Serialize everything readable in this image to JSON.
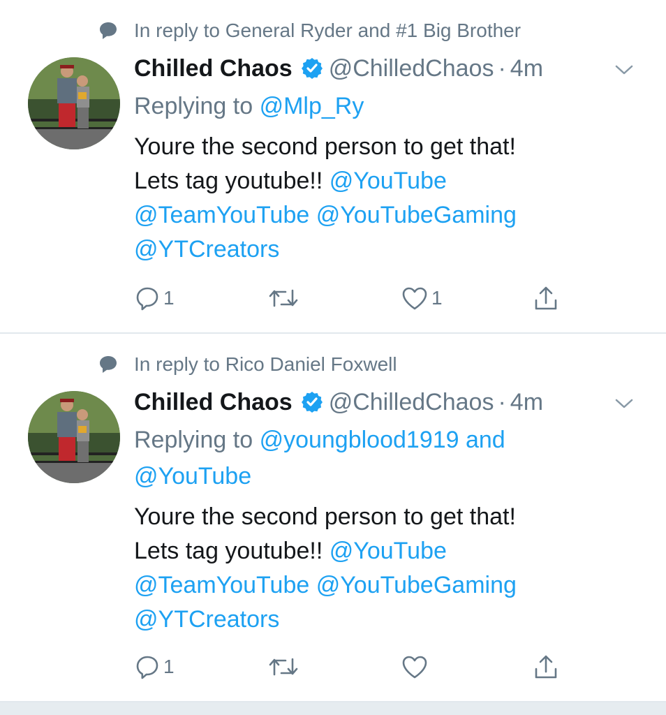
{
  "tweets": [
    {
      "context_text": "In reply to General Ryder and #1 Big Brother",
      "name": "Chilled Chaos",
      "handle": "@ChilledChaos",
      "dot": "·",
      "time": "4m",
      "replying_prefix": "Replying to",
      "replying_line1": "@Mlp_Ry",
      "replying_line2": "",
      "text_line1": "Youre the second person to get that!",
      "text_line2_plain": "Lets tag youtube!!",
      "text_line2_mention": "@YouTube",
      "text_line3": "@TeamYouTube @YouTubeGaming",
      "text_line4": "@YTCreators",
      "reply_count": "1",
      "retweet_count": "",
      "like_count": "1"
    },
    {
      "context_text": "In reply to Rico Daniel Foxwell",
      "name": "Chilled Chaos",
      "handle": "@ChilledChaos",
      "dot": "·",
      "time": "4m",
      "replying_prefix": "Replying to",
      "replying_line1": "@youngblood1919 and",
      "replying_line2": "@YouTube",
      "text_line1": "Youre the second person to get that!",
      "text_line2_plain": "Lets tag youtube!!",
      "text_line2_mention": "@YouTube",
      "text_line3": "@TeamYouTube @YouTubeGaming",
      "text_line4": "@YTCreators",
      "reply_count": "1",
      "retweet_count": "",
      "like_count": ""
    }
  ],
  "icons": {
    "context": "speech-bubble-icon",
    "verified": "verified-badge-icon",
    "caret": "chevron-down-icon",
    "reply": "reply-icon",
    "retweet": "retweet-icon",
    "like": "heart-icon",
    "share": "share-icon"
  },
  "colors": {
    "link": "#1da1f2",
    "secondary": "#657786",
    "divider": "#e1e8ed"
  }
}
